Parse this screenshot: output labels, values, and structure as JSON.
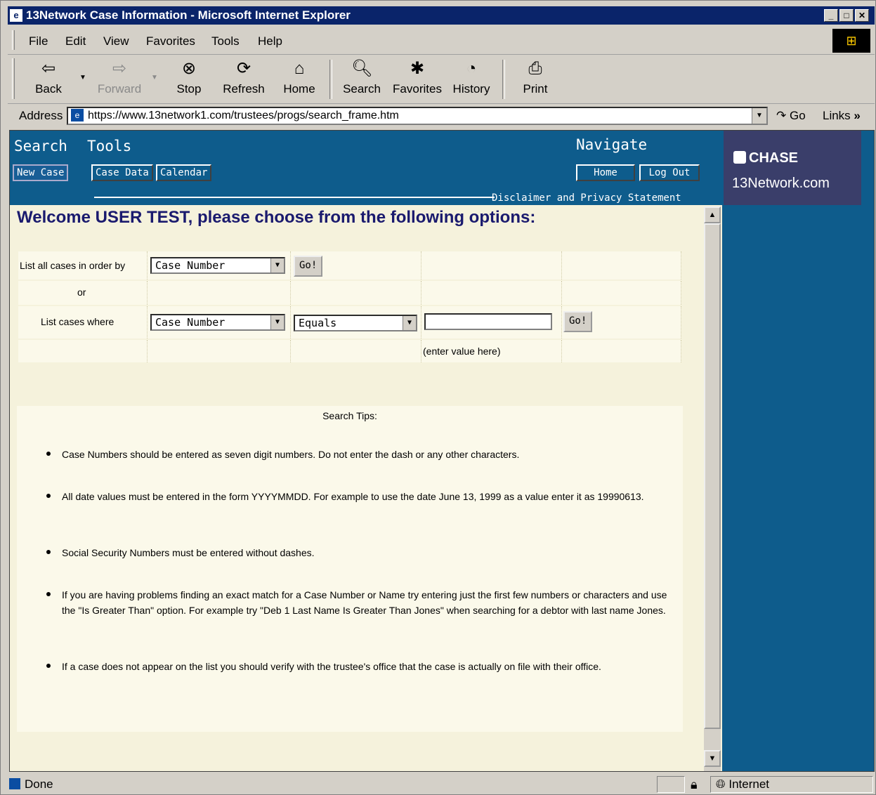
{
  "window": {
    "title": "13Network Case Information - Microsoft Internet Explorer"
  },
  "menu": [
    "File",
    "Edit",
    "View",
    "Favorites",
    "Tools",
    "Help"
  ],
  "toolbar": {
    "back": "Back",
    "forward": "Forward",
    "stop": "Stop",
    "refresh": "Refresh",
    "home": "Home",
    "search": "Search",
    "favorites": "Favorites",
    "history": "History",
    "print": "Print"
  },
  "address": {
    "label": "Address",
    "url": "https://www.13network1.com/trustees/progs/search_frame.htm",
    "go": "Go",
    "links": "Links"
  },
  "header": {
    "search_tab": "Search",
    "tools_tab": "Tools",
    "navigate_tab": "Navigate",
    "new_case": "New Case",
    "case_data": "Case Data",
    "calendar": "Calendar",
    "home": "Home",
    "logout": "Log Out",
    "disclaimer": "Disclaimer and Privacy Statement"
  },
  "brand": {
    "name": "CHASE",
    "site": "13Network.com"
  },
  "welcome": "Welcome USER TEST, please choose from the following options:",
  "form": {
    "list_all_label": "List all cases in order by",
    "order_by_value": "Case Number",
    "go_label": "Go!",
    "or_label": "or",
    "list_where_label": "List cases where",
    "field_value": "Case Number",
    "operator_value": "Equals",
    "value_input": "",
    "value_hint": "(enter value here)"
  },
  "tips": {
    "heading": "Search Tips:",
    "items": [
      "Case Numbers should be entered as seven digit numbers.   Do not enter the dash or any other characters.",
      "All date values must be entered in the form YYYYMMDD.   For example to use the date June 13, 1999 as a value enter it as 19990613.",
      "Social Security Numbers must be entered without dashes.",
      "If you are having problems finding an exact match for a Case Number or Name try entering just the first few numbers or characters and use the \"Is Greater Than\" option.  For example try \"Deb 1 Last Name Is Greater Than Jones\" when searching for a debtor with last name Jones.",
      "If a case does not appear on the list you should verify with the trustee's office that the case is actually on file with their office."
    ]
  },
  "status": {
    "text": "Done",
    "zone": "Internet"
  }
}
